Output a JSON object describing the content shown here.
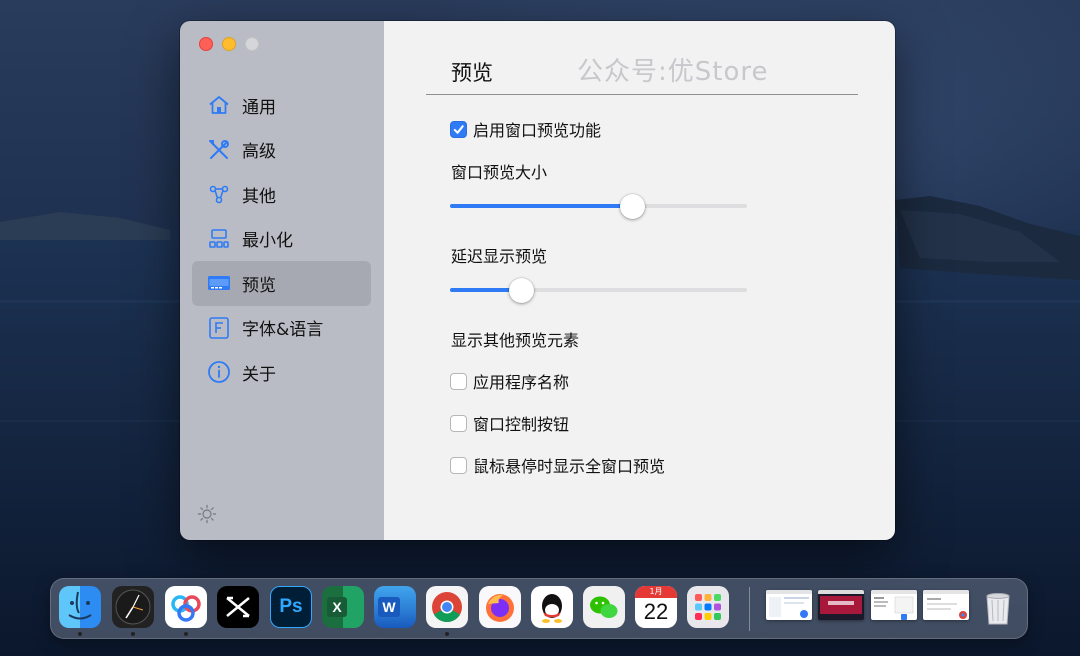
{
  "sidebar": {
    "items": [
      {
        "label": "通用",
        "icon": "house-icon"
      },
      {
        "label": "高级",
        "icon": "tools-icon"
      },
      {
        "label": "其他",
        "icon": "molecule-icon"
      },
      {
        "label": "最小化",
        "icon": "windows-icon"
      },
      {
        "label": "预览",
        "icon": "preview-window-icon",
        "active": true
      },
      {
        "label": "字体&语言",
        "icon": "font-icon"
      },
      {
        "label": "关于",
        "icon": "info-icon"
      }
    ]
  },
  "content": {
    "title": "预览",
    "watermark": "公众号:优Store",
    "enable_preview": {
      "label": "启用窗口预览功能",
      "checked": true
    },
    "preview_size": {
      "label": "窗口预览大小",
      "value": 0.615
    },
    "delay_preview": {
      "label": "延迟显示预览",
      "value": 0.24
    },
    "show_elements_label": "显示其他预览元素",
    "options": [
      {
        "label": "应用程序名称",
        "checked": false
      },
      {
        "label": "窗口控制按钮",
        "checked": false
      },
      {
        "label": "鼠标悬停时显示全窗口预览",
        "checked": false
      }
    ]
  },
  "dock": {
    "calendar_month": "1月",
    "calendar_day": "22",
    "ps_label": "Ps",
    "excel_label": "X",
    "word_label": "W"
  },
  "colors": {
    "accent": "#2f7bf5",
    "sidebar_bg": "#b9bcc4",
    "content_bg": "#f2f2f3"
  }
}
